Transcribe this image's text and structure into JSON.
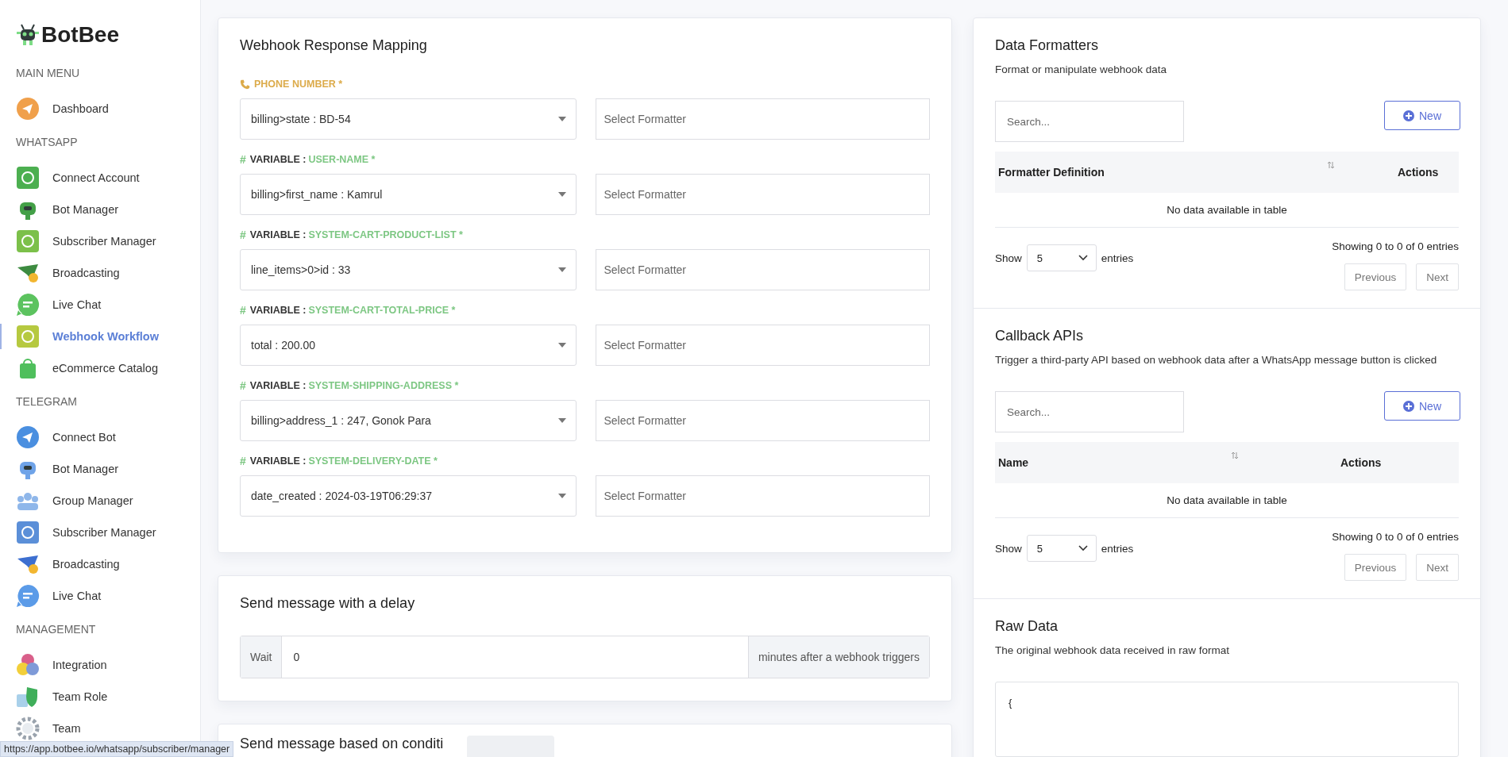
{
  "brand": {
    "name": "BotBee"
  },
  "sidebar": {
    "sections": [
      {
        "title": "MAIN MENU",
        "items": [
          {
            "label": "Dashboard",
            "selected": false
          }
        ]
      },
      {
        "title": "WHATSAPP",
        "items": [
          {
            "label": "Connect Account",
            "selected": false
          },
          {
            "label": "Bot Manager",
            "selected": false
          },
          {
            "label": "Subscriber Manager",
            "selected": false
          },
          {
            "label": "Broadcasting",
            "selected": false
          },
          {
            "label": "Live Chat",
            "selected": false
          },
          {
            "label": "Webhook Workflow",
            "selected": true
          },
          {
            "label": "eCommerce Catalog",
            "selected": false
          }
        ]
      },
      {
        "title": "TELEGRAM",
        "items": [
          {
            "label": "Connect Bot",
            "selected": false
          },
          {
            "label": "Bot Manager",
            "selected": false
          },
          {
            "label": "Group Manager",
            "selected": false
          },
          {
            "label": "Subscriber Manager",
            "selected": false
          },
          {
            "label": "Broadcasting",
            "selected": false
          },
          {
            "label": "Live Chat",
            "selected": false
          }
        ]
      },
      {
        "title": "MANAGEMENT",
        "items": [
          {
            "label": "Integration",
            "selected": false
          },
          {
            "label": "Team Role",
            "selected": false
          },
          {
            "label": "Team",
            "selected": false
          }
        ]
      }
    ]
  },
  "mapping": {
    "title": "Webhook Response Mapping",
    "rows": [
      {
        "kind": "phone",
        "name": "PHONE NUMBER *",
        "value": "billing>state : BD-54",
        "formatter_placeholder": "Select Formatter"
      },
      {
        "kind": "variable",
        "prefix": "#",
        "tag": "VARIABLE :",
        "name": "USER-NAME *",
        "value": "billing>first_name : Kamrul",
        "formatter_placeholder": "Select Formatter"
      },
      {
        "kind": "variable",
        "prefix": "#",
        "tag": "VARIABLE :",
        "name": "SYSTEM-CART-PRODUCT-LIST *",
        "value": "line_items>0>id : 33",
        "formatter_placeholder": "Select Formatter"
      },
      {
        "kind": "variable",
        "prefix": "#",
        "tag": "VARIABLE :",
        "name": "SYSTEM-CART-TOTAL-PRICE *",
        "value": "total : 200.00",
        "formatter_placeholder": "Select Formatter"
      },
      {
        "kind": "variable",
        "prefix": "#",
        "tag": "VARIABLE :",
        "name": "SYSTEM-SHIPPING-ADDRESS *",
        "value": "billing>address_1 : 247, Gonok Para",
        "formatter_placeholder": "Select Formatter"
      },
      {
        "kind": "variable",
        "prefix": "#",
        "tag": "VARIABLE :",
        "name": "SYSTEM-DELIVERY-DATE *",
        "value": "date_created : 2024-03-19T06:29:37",
        "formatter_placeholder": "Select Formatter"
      }
    ]
  },
  "delay": {
    "title": "Send message with a delay",
    "prefix": "Wait",
    "value": "0",
    "suffix": "minutes after a webhook triggers"
  },
  "condition": {
    "title": "Send message based on conditi"
  },
  "side_sections": [
    {
      "title": "Data Formatters",
      "subtitle": "Format or manipulate webhook data",
      "search_placeholder": "Search...",
      "new_label": "New",
      "columns": [
        "Formatter Definition",
        "Actions"
      ],
      "empty": "No data available in table",
      "show_label": "Show",
      "page_size": "5",
      "entries_label": "entries",
      "info": "Showing 0 to 0 of 0 entries",
      "prev": "Previous",
      "next": "Next"
    },
    {
      "title": "Callback APIs",
      "subtitle": "Trigger a third-party API based on webhook data after a WhatsApp message button is clicked",
      "search_placeholder": "Search...",
      "new_label": "New",
      "columns": [
        "Name",
        "Actions"
      ],
      "empty": "No data available in table",
      "show_label": "Show",
      "page_size": "5",
      "entries_label": "entries",
      "info": "Showing 0 to 0 of 0 entries",
      "prev": "Previous",
      "next": "Next"
    }
  ],
  "raw": {
    "title": "Raw Data",
    "subtitle": "The original webhook data received in raw format",
    "lines": [
      "{"
    ]
  },
  "status_bar": {
    "url": "https://app.botbee.io/whatsapp/subscriber/manager"
  }
}
